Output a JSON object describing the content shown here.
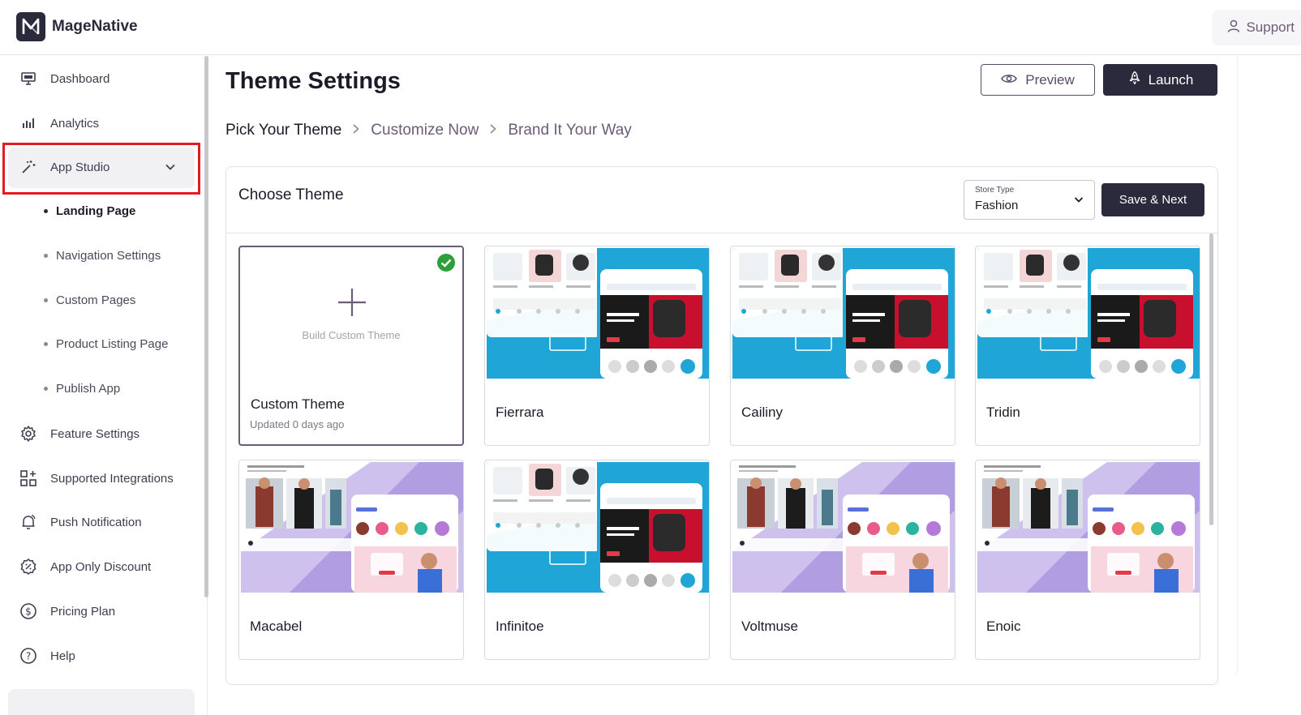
{
  "header": {
    "brand": "MageNative",
    "support": "Support"
  },
  "sidebar": {
    "items": [
      {
        "label": "Dashboard",
        "icon": "monitor-icon"
      },
      {
        "label": "Analytics",
        "icon": "bar-chart-icon"
      },
      {
        "label": "App Studio",
        "icon": "magic-wand-icon",
        "expanded": true
      },
      {
        "label": "Feature Settings",
        "icon": "gear-icon"
      },
      {
        "label": "Supported Integrations",
        "icon": "grid-plus-icon"
      },
      {
        "label": "Push Notification",
        "icon": "bell-icon"
      },
      {
        "label": "App Only Discount",
        "icon": "discount-badge-icon"
      },
      {
        "label": "Pricing Plan",
        "icon": "dollar-circle-icon"
      },
      {
        "label": "Help",
        "icon": "question-circle-icon"
      }
    ],
    "sub_items": [
      "Landing Page",
      "Navigation Settings",
      "Custom Pages",
      "Product Listing Page",
      "Publish App"
    ],
    "active_sub_item": "Landing Page"
  },
  "page": {
    "title": "Theme Settings",
    "preview_label": "Preview",
    "launch_label": "Launch"
  },
  "steps": {
    "step1": "Pick Your Theme",
    "step2": "Customize Now",
    "step3": "Brand It Your Way"
  },
  "choose": {
    "title": "Choose Theme",
    "store_type_label": "Store Type",
    "store_type_value": "Fashion",
    "save_label": "Save & Next"
  },
  "themes": [
    {
      "name": "Custom Theme",
      "caption": "Build Custom Theme",
      "updated": "Updated 0 days ago",
      "selected": true
    },
    {
      "name": "Fierrara",
      "style": "electronics"
    },
    {
      "name": "Cailiny",
      "style": "electronics"
    },
    {
      "name": "Tridin",
      "style": "electronics"
    },
    {
      "name": "Macabel",
      "style": "fashion"
    },
    {
      "name": "Infinitoe",
      "style": "electronics"
    },
    {
      "name": "Voltmuse",
      "style": "fashion"
    },
    {
      "name": "Enoic",
      "style": "fashion"
    }
  ],
  "colors": {
    "primary": "#2a2a3c",
    "accent": "#6b5c7a",
    "highlight": "#e31b23",
    "success": "#2e9e3a"
  }
}
